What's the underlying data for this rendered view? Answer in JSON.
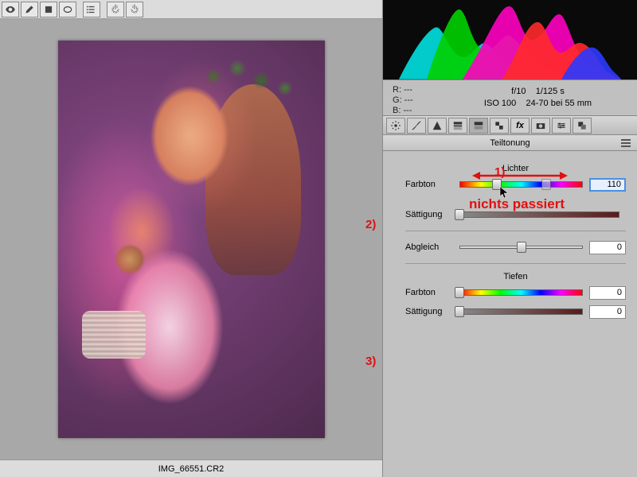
{
  "file": {
    "name": "IMG_66551.CR2"
  },
  "toolbar": {
    "tools": [
      "eye",
      "brush",
      "square",
      "ellipse",
      "list",
      "rotate-ccw",
      "rotate-cw"
    ]
  },
  "meta": {
    "R": "---",
    "G": "---",
    "B": "---",
    "aperture": "f/10",
    "shutter": "1/125 s",
    "iso": "ISO 100",
    "lens": "24-70 bei 55 mm"
  },
  "tabs": [
    "lens",
    "tone",
    "bw",
    "hsl",
    "split",
    "detail",
    "fx",
    "camera",
    "presets",
    "snapshot"
  ],
  "panel": {
    "title": "Teiltonung",
    "highlights": {
      "title": "Lichter",
      "hue_label": "Farbton",
      "hue_value": "110",
      "sat_label": "Sättigung"
    },
    "balance": {
      "label": "Abgleich",
      "value": "0"
    },
    "shadows": {
      "title": "Tiefen",
      "hue_label": "Farbton",
      "hue_value": "0",
      "sat_label": "Sättigung",
      "sat_value": "0"
    }
  },
  "annotations": {
    "a1": "1)",
    "a2": "2)",
    "a3": "3)",
    "note": "nichts passiert"
  }
}
